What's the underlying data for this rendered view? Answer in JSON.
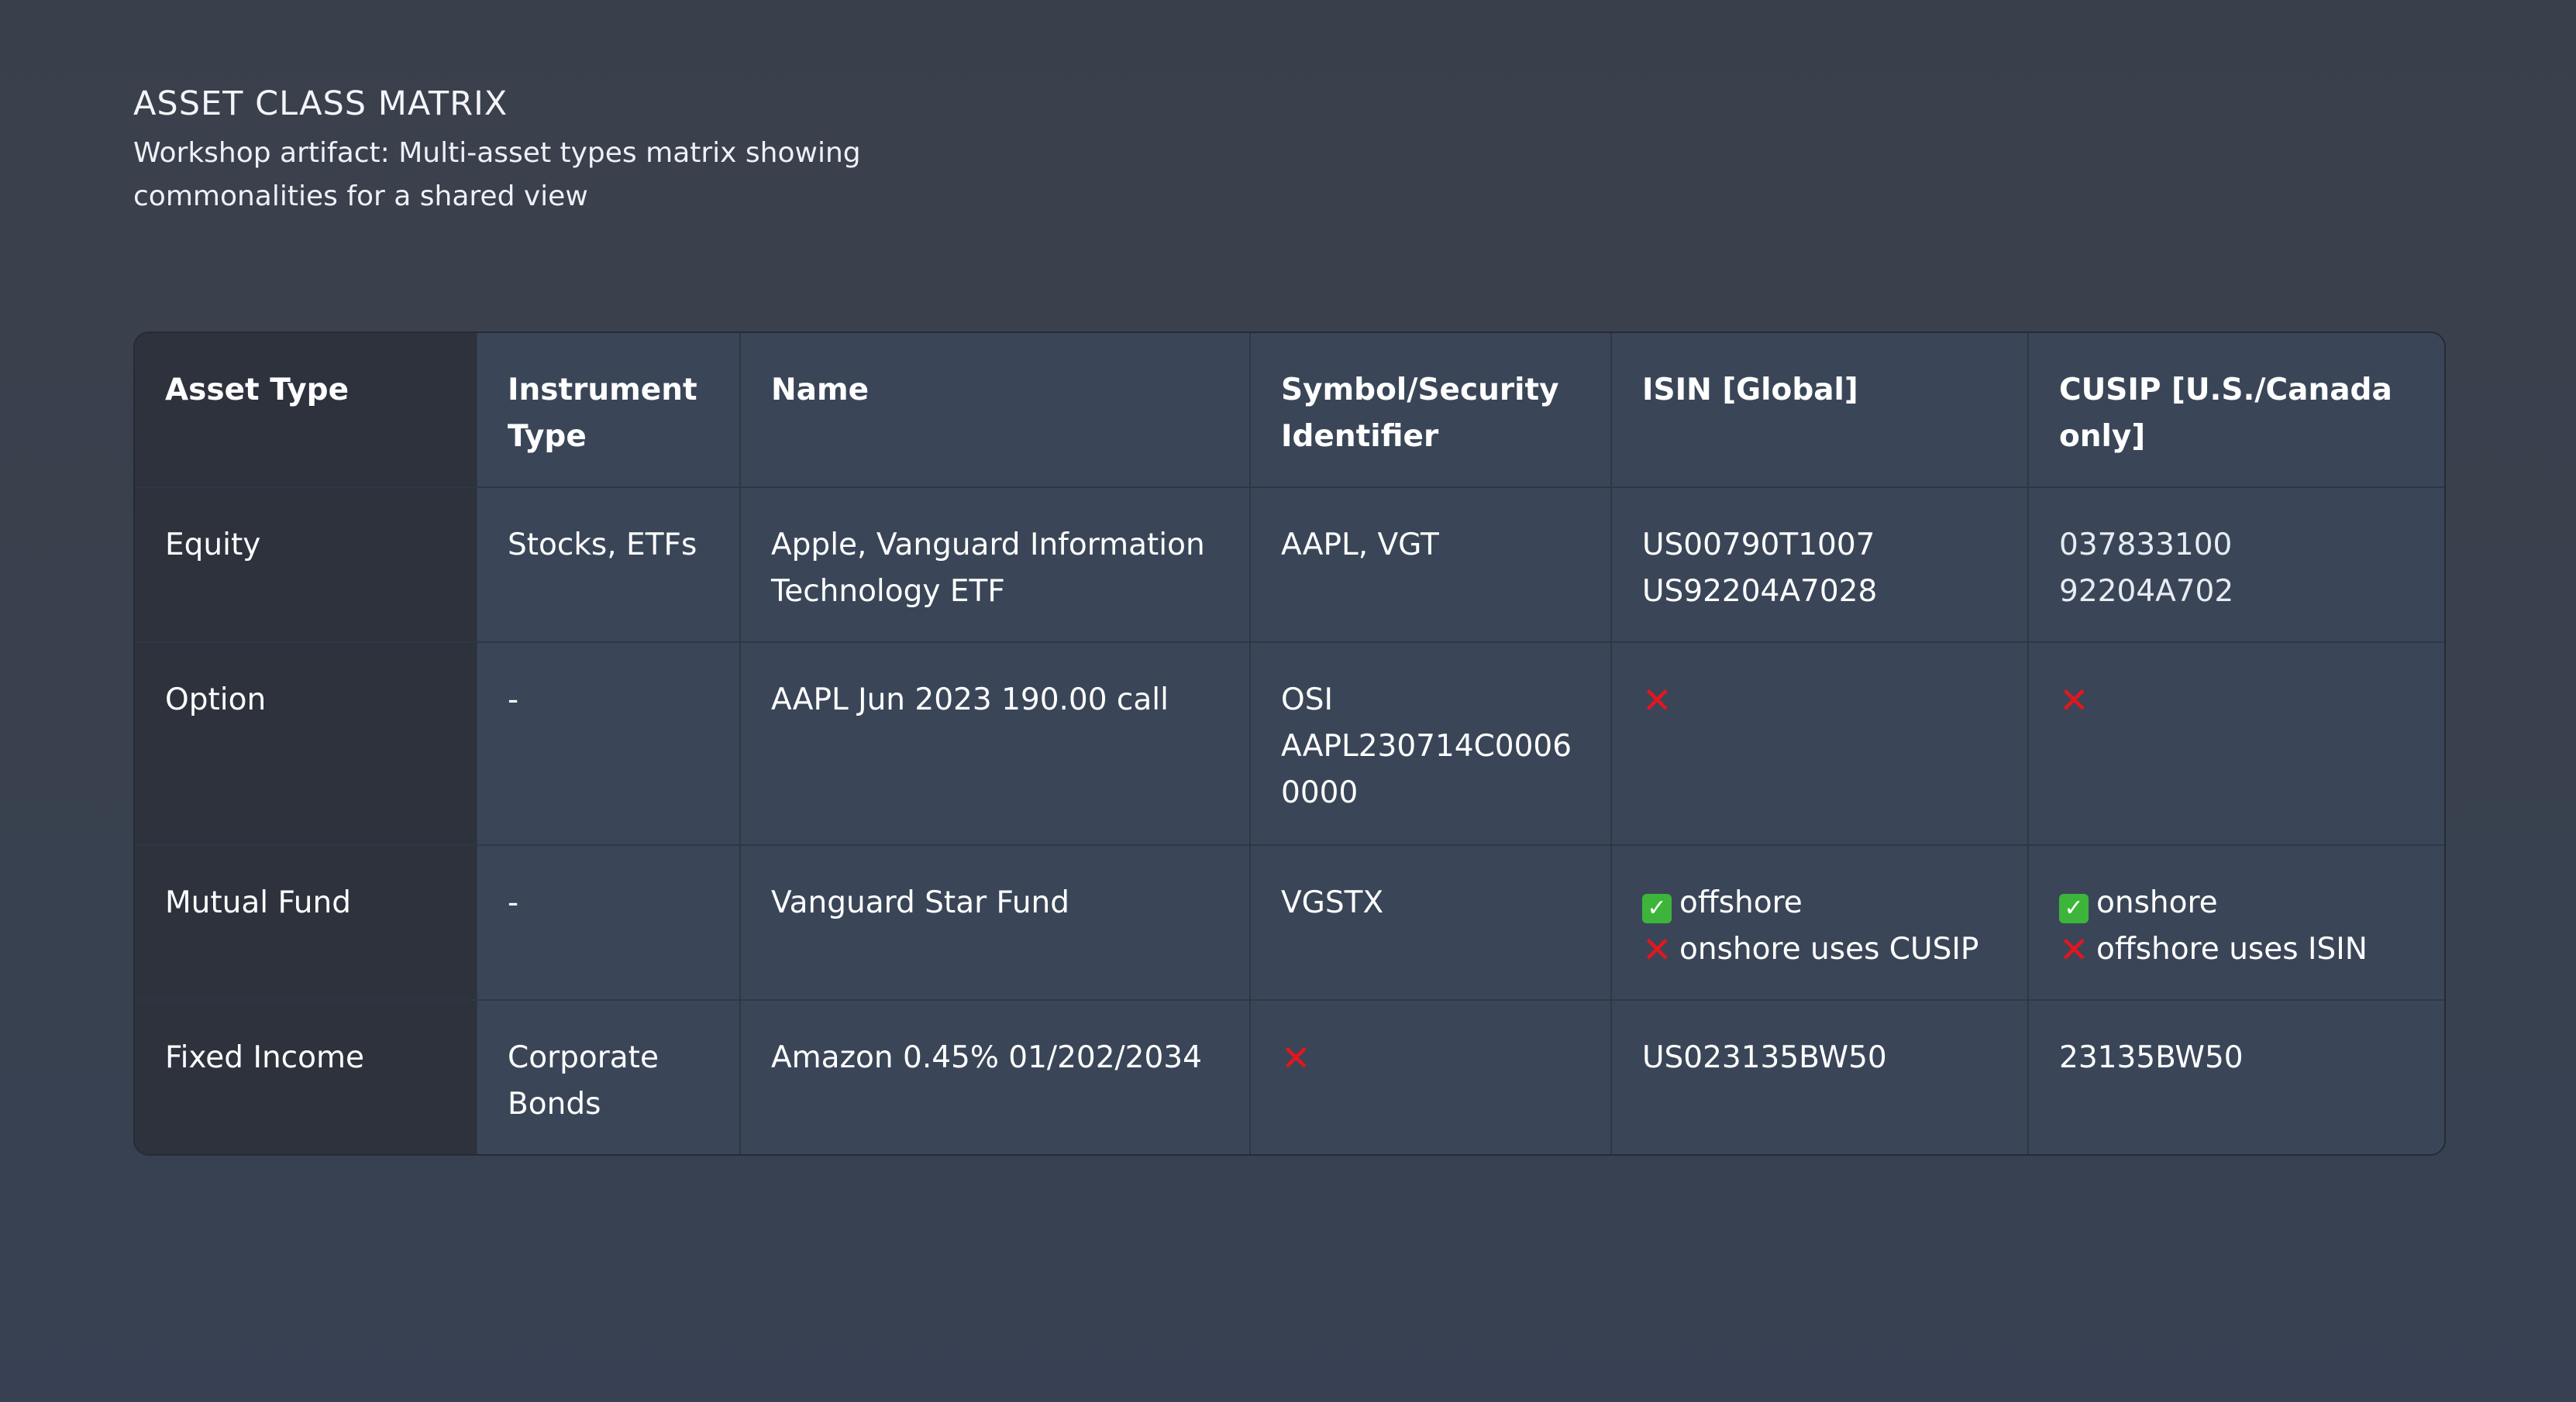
{
  "header": {
    "title": "ASSET CLASS MATRIX",
    "subtitle": "Workshop artifact: Multi-asset types matrix showing commonalities for a shared view"
  },
  "matrix": {
    "columns": [
      "Asset Type",
      "Instrument Type",
      "Name",
      "Symbol/Security Identifier",
      "ISIN [Global]",
      "CUSIP [U.S./Canada only]"
    ],
    "rows": [
      {
        "asset_type": "Equity",
        "instrument_type": "Stocks, ETFs",
        "name": "Apple, Vanguard Information Technology ETF",
        "symbol": "AAPL, VGT",
        "isin": [
          "US00790T1007",
          "US92204A7028"
        ],
        "cusip": [
          "037833100",
          "92204A702"
        ]
      },
      {
        "asset_type": "Option",
        "instrument_type": "-",
        "name": "AAPL Jun 2023 190.00 call",
        "symbol": [
          "OSI",
          "AAPL230714C00060000"
        ],
        "isin": "x",
        "cusip": "x"
      },
      {
        "asset_type": "Mutual Fund",
        "instrument_type": "-",
        "name": "Vanguard Star Fund",
        "symbol": "VGSTX",
        "isin": [
          {
            "icon": "check",
            "text": "offshore"
          },
          {
            "icon": "x",
            "text": "onshore uses CUSIP"
          }
        ],
        "cusip": [
          {
            "icon": "check",
            "text": "onshore"
          },
          {
            "icon": "x",
            "text": "offshore uses ISIN"
          }
        ]
      },
      {
        "asset_type": "Fixed Income",
        "instrument_type": "Corporate Bonds",
        "name": "Amazon 0.45% 01/202/2034",
        "symbol": "x",
        "isin": "US023135BW50",
        "cusip": "23135BW50"
      }
    ]
  },
  "icons": {
    "x": "cross-mark-icon",
    "check": "check-mark-icon"
  },
  "colors": {
    "cross": "#e3161f",
    "check": "#3cb53a"
  }
}
